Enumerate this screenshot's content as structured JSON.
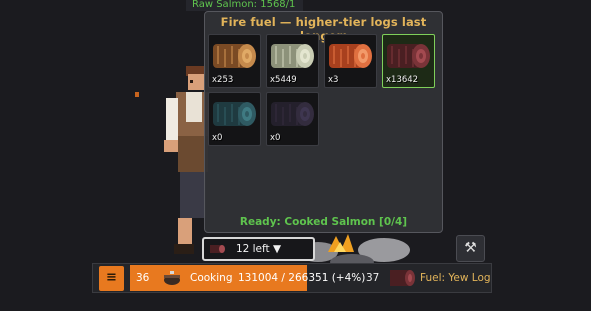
{
  "top_label": "Raw Salmon: 1568/1",
  "popup": {
    "title": "Fire fuel — higher-tier logs last longer:",
    "logs": [
      {
        "count": "x253",
        "bark": "#7a4a24",
        "core": "#c58a4c",
        "ring": "#e0aa66",
        "selected": false
      },
      {
        "count": "x5449",
        "bark": "#8d927a",
        "core": "#c9cdb4",
        "ring": "#e4e6d0",
        "selected": false
      },
      {
        "count": "x3",
        "bark": "#a8401e",
        "core": "#e07040",
        "ring": "#f29a6a",
        "selected": false
      },
      {
        "count": "x13642",
        "bark": "#4a1f22",
        "core": "#7a3338",
        "ring": "#a34a50",
        "selected": true
      },
      {
        "count": "x0",
        "bark": "#1f3a40",
        "core": "#2f5a62",
        "ring": "#3f7a82",
        "selected": false
      },
      {
        "count": "x0",
        "bark": "#24202c",
        "core": "#332c3e",
        "ring": "#3e3650",
        "selected": false
      }
    ],
    "ready_text": "Ready: Cooked Salmon  [0/4]"
  },
  "left_control": {
    "label": "12 left ▼"
  },
  "tool_button": {
    "icon": "crossed-hammers-icon"
  },
  "hud": {
    "menu_icon": "≡",
    "level": "36",
    "skill": "Cooking",
    "xp": "131004 / 266351 (+4%)",
    "progress": 0.49,
    "next_level": "37",
    "fuel_text": "Fuel: Yew Log x"
  },
  "colors": {
    "accent": "#e8791f",
    "green": "#5fc44e",
    "gold": "#e2b45a"
  }
}
